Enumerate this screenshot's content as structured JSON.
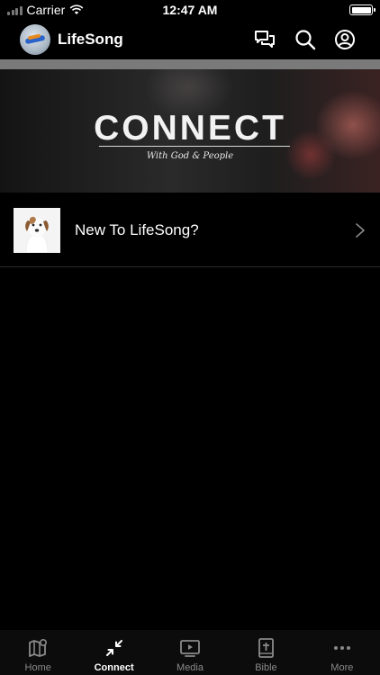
{
  "status_bar": {
    "carrier": "Carrier",
    "time": "12:47 AM"
  },
  "header": {
    "title": "LifeSong"
  },
  "banner": {
    "title": "CONNECT",
    "subtitle": "With God & People"
  },
  "list": [
    {
      "label": "New To LifeSong?"
    }
  ],
  "tabs": [
    {
      "label": "Home",
      "icon": "map-icon",
      "active": false
    },
    {
      "label": "Connect",
      "icon": "connect-arrows-icon",
      "active": true
    },
    {
      "label": "Media",
      "icon": "play-screen-icon",
      "active": false
    },
    {
      "label": "Bible",
      "icon": "bible-icon",
      "active": false
    },
    {
      "label": "More",
      "icon": "more-dots-icon",
      "active": false
    }
  ],
  "colors": {
    "background": "#000000",
    "active_tab": "#ffffff",
    "inactive_tab": "#8a8a8a",
    "divider": "#7a7a7a"
  }
}
